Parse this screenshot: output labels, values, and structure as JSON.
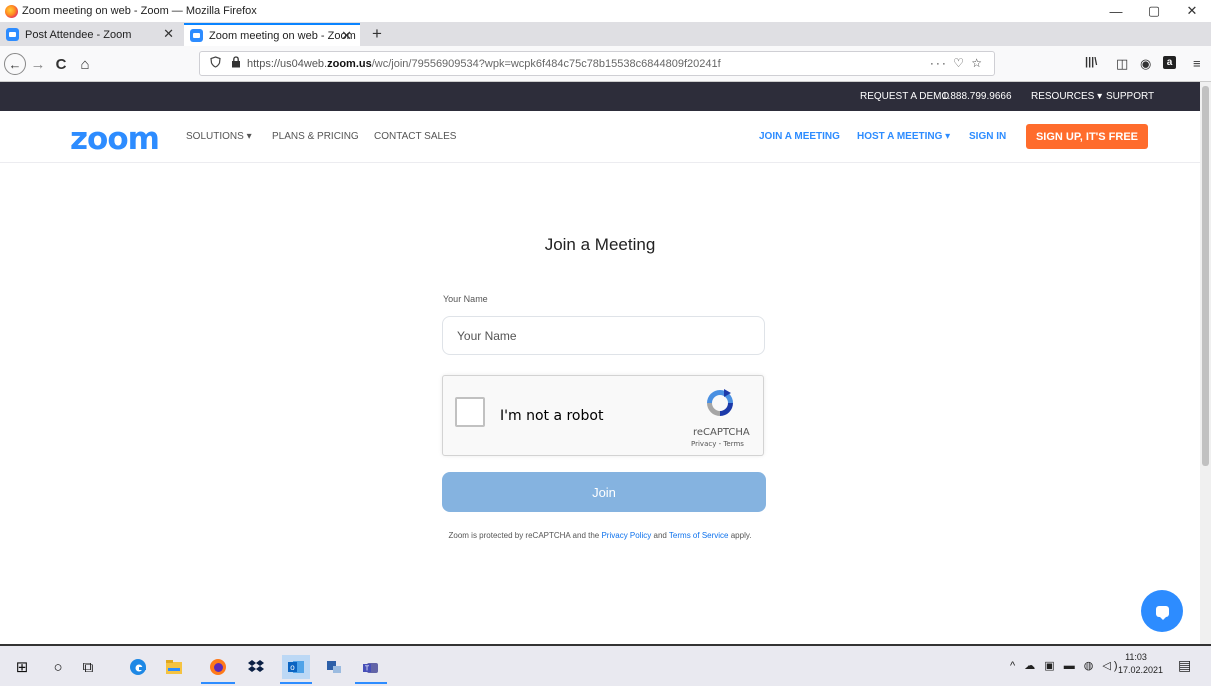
{
  "window": {
    "title": "Zoom meeting on web - Zoom — Mozilla Firefox",
    "minimize": "—",
    "maximize": "▢",
    "close": "✕"
  },
  "tabs": [
    {
      "label": "Post Attendee - Zoom",
      "close": "✕",
      "active": false
    },
    {
      "label": "Zoom meeting on web - Zoom",
      "close": "✕",
      "active": true
    }
  ],
  "new_tab": "+",
  "nav": {
    "back": "←",
    "forward": "→",
    "reload": "C",
    "home": "⌂"
  },
  "urlbar": {
    "prefix": "https://us04web.",
    "domain": "zoom.us",
    "tail": "/wc/join/79556909534?wpk=wcpk6f484c75c78b15538c6844809f20241f",
    "page_actions": "··· ♡ ☆"
  },
  "toolbar_icons": {
    "library": "|||\\",
    "sidebar": "◫",
    "account": "◉",
    "amazon": "a",
    "menu": "≡"
  },
  "zoom_top": {
    "request_demo": "REQUEST A DEMO",
    "phone": "1.888.799.9666",
    "resources": "RESOURCES ▾",
    "support": "SUPPORT"
  },
  "zoom_header": {
    "logo": "zoom",
    "solutions": "SOLUTIONS ▾",
    "plans": "PLANS & PRICING",
    "contact": "CONTACT SALES",
    "join": "JOIN A MEETING",
    "host": "HOST A MEETING ▾",
    "signin": "SIGN IN",
    "signup": "SIGN UP, IT'S FREE"
  },
  "form": {
    "title": "Join a Meeting",
    "name_label": "Your Name",
    "name_placeholder": "Your Name",
    "join_button": "Join"
  },
  "recaptcha": {
    "text": "I'm not a robot",
    "brand": "reCAPTCHA",
    "links": "Privacy - Terms"
  },
  "legal": {
    "pre": "Zoom is protected by reCAPTCHA and the ",
    "privacy": "Privacy Policy",
    "mid": " and ",
    "terms": "Terms of Service",
    "post": " apply."
  },
  "taskbar": {
    "start": "⊞",
    "search": "○",
    "taskview": "⧉",
    "tray": "^ ☁ ▣ ▬ ◍ ◁)",
    "time": "11:03",
    "date": "17.02.2021",
    "notifications": "▤"
  },
  "colors": {
    "zoom_blue": "#2d8cff",
    "signup_orange": "#ff6c2c",
    "join_disabled": "#85b3e0",
    "topbar_dark": "#2d2d3a"
  }
}
